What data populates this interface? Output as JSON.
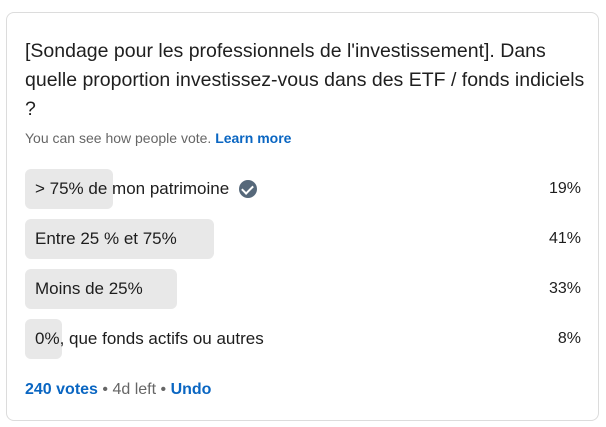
{
  "poll": {
    "question": "[Sondage pour les professionnels de l'investissement]. Dans quelle proportion investissez-vous dans des ETF / fonds indiciels ?",
    "note_text": "You can see how people vote.",
    "note_link": "Learn more",
    "options": [
      {
        "label": "> 75% de mon patrimoine",
        "percent": "19%",
        "fraction": 0.19,
        "selected": true
      },
      {
        "label": "Entre 25 % et 75%",
        "percent": "41%",
        "fraction": 0.41,
        "selected": false
      },
      {
        "label": "Moins de 25%",
        "percent": "33%",
        "fraction": 0.33,
        "selected": false
      },
      {
        "label": "0%, que fonds actifs ou autres",
        "percent": "8%",
        "fraction": 0.08,
        "selected": false
      }
    ],
    "footer": {
      "votes": "240 votes",
      "separator": "•",
      "time_left": "4d left",
      "undo": "Undo"
    }
  },
  "colors": {
    "link": "#0a66c2",
    "bar": "#e8e8e8",
    "check": "#56687a"
  },
  "icons": {
    "selected": "check-circle-icon"
  }
}
